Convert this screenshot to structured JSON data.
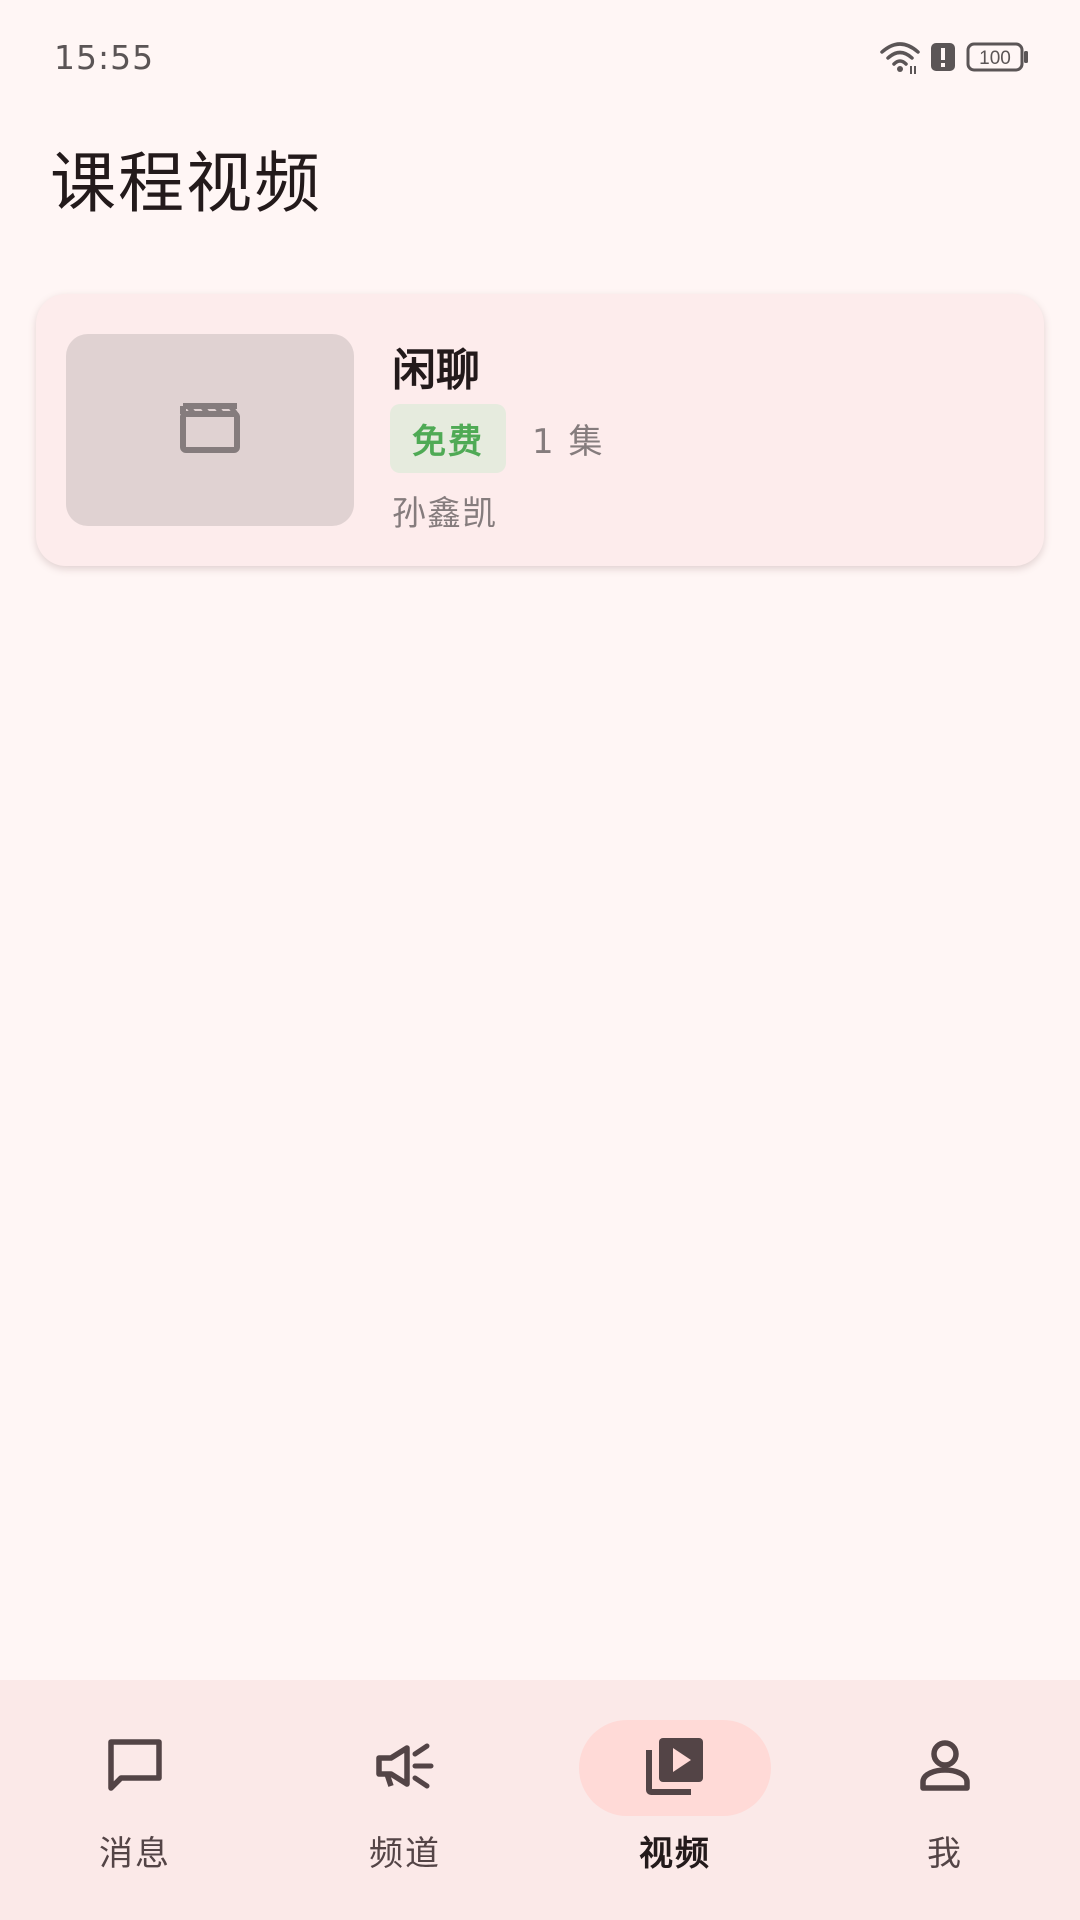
{
  "status_bar": {
    "time": "15:55",
    "battery": "100",
    "icons": [
      "wifi-icon",
      "alert-icon",
      "battery-icon"
    ]
  },
  "page": {
    "title": "课程视频"
  },
  "courses": [
    {
      "title": "闲聊",
      "tag": "免费",
      "episodes": "1 集",
      "author": "孙鑫凯",
      "thumbnail_icon": "clapperboard-icon"
    }
  ],
  "bottom_nav": {
    "items": [
      {
        "label": "消息",
        "icon": "chat-bubble-icon",
        "active": false
      },
      {
        "label": "频道",
        "icon": "megaphone-icon",
        "active": false
      },
      {
        "label": "视频",
        "icon": "video-library-icon",
        "active": true
      },
      {
        "label": "我",
        "icon": "person-icon",
        "active": false
      }
    ]
  },
  "colors": {
    "background": "#FFF6F5",
    "card": "#FDECEC",
    "free_tag_text": "#4FAA55",
    "free_tag_bg": "#E6EBDE",
    "nav_bg": "#FBE9E8",
    "nav_active_pill": "#FFDAD7"
  }
}
